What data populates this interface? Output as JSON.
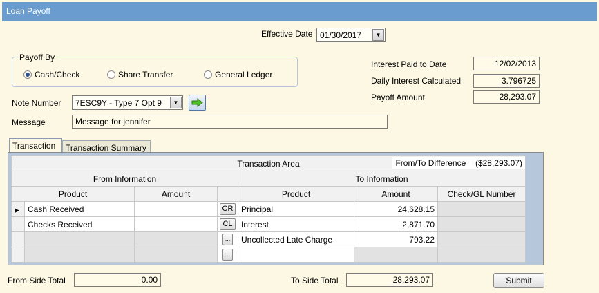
{
  "window": {
    "title": "Loan Payoff"
  },
  "effective_date": {
    "label": "Effective Date",
    "value": "01/30/2017"
  },
  "payoff_by": {
    "label": "Payoff By",
    "options": [
      {
        "label": "Cash/Check",
        "selected": true
      },
      {
        "label": "Share Transfer",
        "selected": false
      },
      {
        "label": "General Ledger",
        "selected": false
      }
    ]
  },
  "summary": {
    "interest_paid_to_date": {
      "label": "Interest Paid to Date",
      "value": "12/02/2013"
    },
    "daily_interest": {
      "label": "Daily Interest Calculated",
      "value": "3.796725"
    },
    "payoff_amount": {
      "label": "Payoff Amount",
      "value": "28,293.07"
    }
  },
  "note_number": {
    "label": "Note Number",
    "value": "7ESC9Y - Type 7 Opt 9"
  },
  "message": {
    "label": "Message",
    "value": "Message for jennifer"
  },
  "tabs": [
    {
      "label": "Transaction",
      "active": true
    },
    {
      "label": "Transaction Summary",
      "active": false
    }
  ],
  "grid": {
    "area_title": "Transaction Area",
    "difference": "From/To Difference = ($28,293.07)",
    "from_header": "From Information",
    "to_header": "To Information",
    "columns": {
      "from_product": "Product",
      "from_amount": "Amount",
      "to_product": "Product",
      "to_amount": "Amount",
      "check_gl": "Check/GL Number"
    },
    "rows": [
      {
        "from_product": "Cash Received",
        "from_amount": "",
        "button": "CR",
        "to_product": "Principal",
        "to_amount": "24,628.15",
        "check_gl": ""
      },
      {
        "from_product": "Checks Received",
        "from_amount": "",
        "button": "CL",
        "to_product": "Interest",
        "to_amount": "2,871.70",
        "check_gl": ""
      },
      {
        "from_product": "",
        "from_amount": "",
        "button": "...",
        "to_product": "Uncollected Late Charge",
        "to_amount": "793.22",
        "check_gl": ""
      },
      {
        "from_product": "",
        "from_amount": "",
        "button": "...",
        "to_product": "",
        "to_amount": "",
        "check_gl": ""
      }
    ]
  },
  "totals": {
    "from_label": "From Side Total",
    "from_value": "0.00",
    "to_label": "To Side Total",
    "to_value": "28,293.07"
  },
  "submit_label": "Submit",
  "colors": {
    "title_bar": "#6a9ccf",
    "background": "#fcf8e4",
    "grid_frame": "#b7c7db"
  }
}
